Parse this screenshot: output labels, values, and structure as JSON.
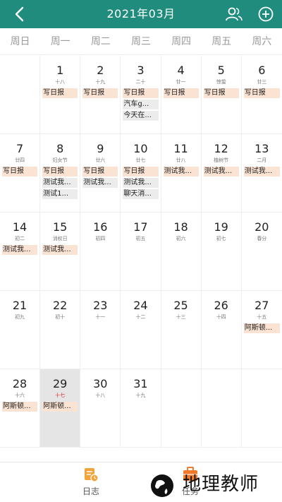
{
  "header": {
    "title": "2021年03月",
    "back_icon": "chevron-left-icon",
    "people_icon": "people-icon",
    "add_icon": "plus-circle-icon",
    "bg_color": "#1f8c7e"
  },
  "weekdays": [
    "周日",
    "周一",
    "周二",
    "周三",
    "周四",
    "周五",
    "周六"
  ],
  "weeks": [
    [
      {
        "day": "",
        "lunar": "",
        "events": []
      },
      {
        "day": "1",
        "lunar": "十八",
        "events": [
          {
            "text": "写日报",
            "style": "orange"
          }
        ]
      },
      {
        "day": "2",
        "lunar": "十九",
        "events": [
          {
            "text": "写日报",
            "style": "orange"
          }
        ]
      },
      {
        "day": "3",
        "lunar": "二十",
        "events": [
          {
            "text": "写日报",
            "style": "orange"
          },
          {
            "text": "汽车g...",
            "style": "grey"
          },
          {
            "text": "今天在...",
            "style": "grey"
          }
        ]
      },
      {
        "day": "4",
        "lunar": "廿一",
        "events": [
          {
            "text": "写日报",
            "style": "orange"
          }
        ]
      },
      {
        "day": "5",
        "lunar": "惊蛰",
        "events": [
          {
            "text": "写日报",
            "style": "orange"
          }
        ]
      },
      {
        "day": "6",
        "lunar": "廿三",
        "events": [
          {
            "text": "写日报",
            "style": "orange"
          }
        ]
      }
    ],
    [
      {
        "day": "7",
        "lunar": "廿四",
        "events": [
          {
            "text": "写日报",
            "style": "orange"
          }
        ]
      },
      {
        "day": "8",
        "lunar": "妇女节",
        "events": [
          {
            "text": "写日报",
            "style": "orange"
          },
          {
            "text": "测试我...",
            "style": "grey"
          },
          {
            "text": "测试1...",
            "style": "grey"
          }
        ]
      },
      {
        "day": "9",
        "lunar": "廿六",
        "events": [
          {
            "text": "写日报",
            "style": "orange"
          },
          {
            "text": "测试我...",
            "style": "grey"
          }
        ]
      },
      {
        "day": "10",
        "lunar": "廿七",
        "events": [
          {
            "text": "写日报",
            "style": "orange"
          },
          {
            "text": "测试我...",
            "style": "grey"
          },
          {
            "text": "聊天消...",
            "style": "grey"
          }
        ]
      },
      {
        "day": "11",
        "lunar": "廿八",
        "events": [
          {
            "text": "测试我...",
            "style": "orange"
          }
        ]
      },
      {
        "day": "12",
        "lunar": "植树节",
        "events": [
          {
            "text": "测试我...",
            "style": "orange"
          }
        ]
      },
      {
        "day": "13",
        "lunar": "二月",
        "events": [
          {
            "text": "测试我...",
            "style": "orange"
          }
        ]
      }
    ],
    [
      {
        "day": "14",
        "lunar": "初二",
        "events": [
          {
            "text": "测试我...",
            "style": "orange"
          }
        ]
      },
      {
        "day": "15",
        "lunar": "消权日",
        "events": [
          {
            "text": "测试我...",
            "style": "orange"
          }
        ]
      },
      {
        "day": "16",
        "lunar": "初四",
        "events": []
      },
      {
        "day": "17",
        "lunar": "初五",
        "events": []
      },
      {
        "day": "18",
        "lunar": "初六",
        "events": []
      },
      {
        "day": "19",
        "lunar": "初七",
        "events": []
      },
      {
        "day": "20",
        "lunar": "春分",
        "events": []
      }
    ],
    [
      {
        "day": "21",
        "lunar": "初九",
        "events": []
      },
      {
        "day": "22",
        "lunar": "初十",
        "events": []
      },
      {
        "day": "23",
        "lunar": "十一",
        "events": []
      },
      {
        "day": "24",
        "lunar": "十二",
        "events": []
      },
      {
        "day": "25",
        "lunar": "十三",
        "events": []
      },
      {
        "day": "26",
        "lunar": "十四",
        "events": []
      },
      {
        "day": "27",
        "lunar": "十五",
        "events": [
          {
            "text": "阿斯顿...",
            "style": "orange"
          }
        ]
      }
    ],
    [
      {
        "day": "28",
        "lunar": "十六",
        "events": [
          {
            "text": "阿斯顿...",
            "style": "orange"
          }
        ]
      },
      {
        "day": "29",
        "lunar": "十七",
        "today": true,
        "events": [
          {
            "text": "阿斯顿...",
            "style": "orange"
          }
        ]
      },
      {
        "day": "30",
        "lunar": "十八",
        "events": []
      },
      {
        "day": "31",
        "lunar": "十九",
        "events": []
      },
      {
        "day": "",
        "lunar": "",
        "events": []
      },
      {
        "day": "",
        "lunar": "",
        "events": []
      },
      {
        "day": "",
        "lunar": "",
        "events": []
      }
    ]
  ],
  "tabbar": {
    "tabs": [
      {
        "label": "日志",
        "icon": "journal-icon"
      },
      {
        "label": "任务",
        "icon": "briefcase-icon"
      }
    ],
    "watermark": "地理教师"
  }
}
